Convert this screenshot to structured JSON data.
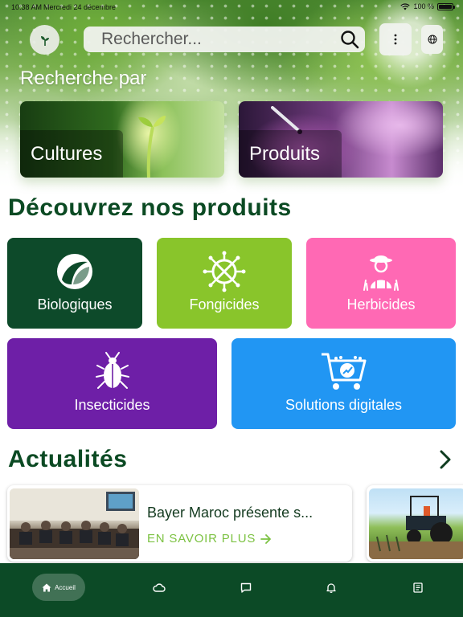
{
  "status_bar": {
    "time": "10:38 AM",
    "date": "Mercredi 24 décembre",
    "battery": "100 %"
  },
  "search": {
    "placeholder": "Rechercher..."
  },
  "search_by": {
    "title": "Recherche par",
    "cards": [
      {
        "label": "Cultures"
      },
      {
        "label": "Produits"
      }
    ]
  },
  "products": {
    "title": "Découvrez nos produits",
    "tiles": [
      {
        "label": "Biologiques",
        "color": "#0d4a2a",
        "icon": "leaf-swirl-icon"
      },
      {
        "label": "Fongicides",
        "color": "#89c52b",
        "icon": "fungicide-icon"
      },
      {
        "label": "Herbicides",
        "color": "#ff69b4",
        "icon": "farmer-icon"
      },
      {
        "label": "Insecticides",
        "color": "#6e1fa7",
        "icon": "beetle-icon"
      },
      {
        "label": "Solutions digitales",
        "color": "#2196f3",
        "icon": "digital-cart-icon"
      }
    ]
  },
  "news": {
    "title": "Actualités",
    "items": [
      {
        "title": "Bayer Maroc présente s...",
        "link_label": "EN SAVOIR PLUS"
      }
    ]
  },
  "bottom_nav": {
    "items": [
      {
        "label": "Accueil",
        "icon": "home-icon",
        "active": true
      },
      {
        "label": "",
        "icon": "cloud-icon"
      },
      {
        "label": "",
        "icon": "chat-icon"
      },
      {
        "label": "",
        "icon": "bell-icon"
      },
      {
        "label": "",
        "icon": "news-icon"
      }
    ]
  },
  "colors": {
    "brand_dark_green": "#0c4a26",
    "accent_green": "#7cc242"
  }
}
